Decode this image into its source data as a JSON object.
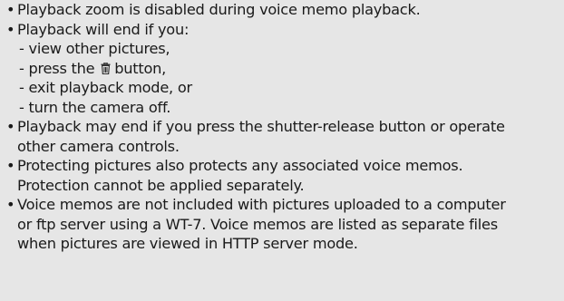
{
  "notes": [
    {
      "bullet": "•",
      "lines": [
        "Playback zoom is disabled during voice memo playback."
      ]
    },
    {
      "bullet": "•",
      "lines": [
        "Playback will end if you:"
      ],
      "subitems": [
        {
          "text": "- view other pictures,"
        },
        {
          "before": "- press the ",
          "icon": "trash-icon",
          "after": "button,"
        },
        {
          "text": "- exit playback mode, or"
        },
        {
          "text": "- turn the camera off."
        }
      ]
    },
    {
      "bullet": "•",
      "lines": [
        "Playback may end if you press the shutter-release button or operate",
        "other camera controls."
      ]
    },
    {
      "bullet": "•",
      "lines": [
        "Protecting pictures also protects any associated voice memos.",
        "Protection cannot be applied separately."
      ]
    },
    {
      "bullet": "•",
      "lines": [
        "Voice memos are not included with pictures uploaded to a computer",
        "or ftp server using a WT-7. Voice memos are listed as separate files",
        "when pictures are viewed in HTTP server mode."
      ]
    }
  ]
}
